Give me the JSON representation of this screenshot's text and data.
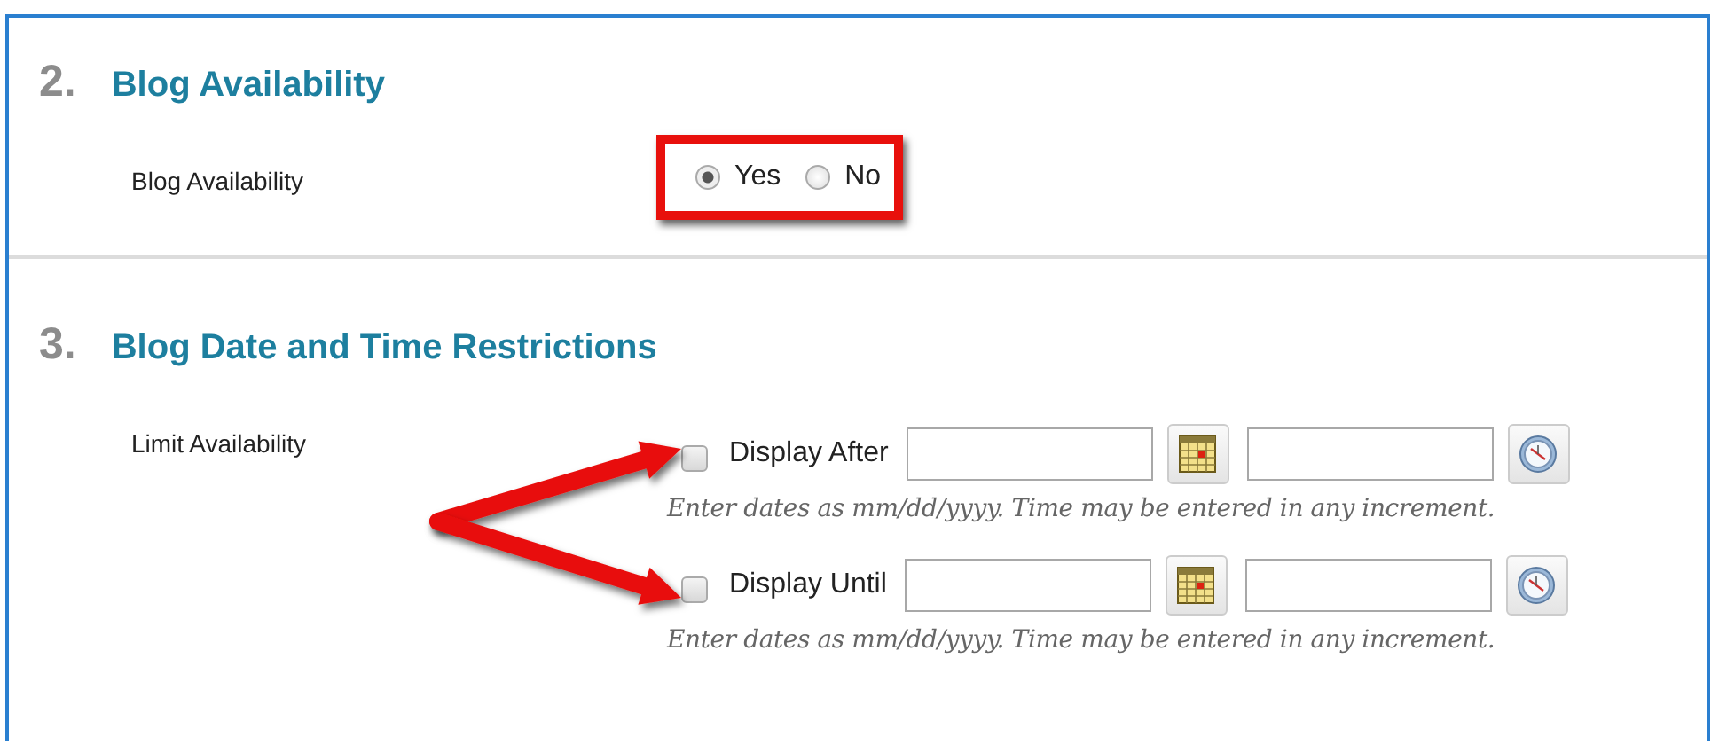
{
  "sections": [
    {
      "number": "2.",
      "title": "Blog Availability",
      "fields": [
        {
          "kind": "radio",
          "label": "Blog Availability",
          "highlighted": true,
          "options": [
            {
              "label": "Yes",
              "selected": true
            },
            {
              "label": "No",
              "selected": false
            }
          ]
        }
      ]
    },
    {
      "number": "3.",
      "title": "Blog Date and Time Restrictions",
      "fields": [
        {
          "kind": "dates",
          "label": "Limit Availability",
          "arrows": true,
          "rows": [
            {
              "label": "Display After",
              "checked": false,
              "hint": "Enter dates as mm/dd/yyyy. Time may be entered in any increment."
            },
            {
              "label": "Display Until",
              "checked": false,
              "hint": "Enter dates as mm/dd/yyyy. Time may be entered in any increment."
            }
          ]
        }
      ]
    }
  ]
}
